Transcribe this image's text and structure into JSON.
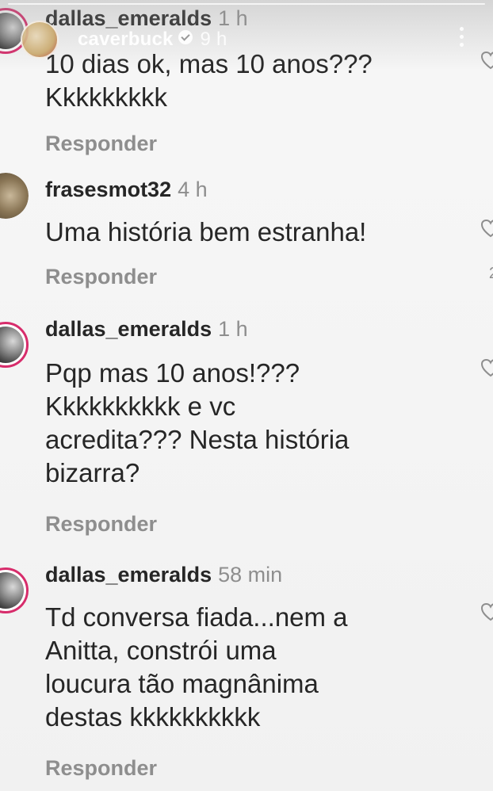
{
  "story": {
    "username": "caverbuck",
    "time": "9 h"
  },
  "comments": [
    {
      "username": "dallas_emeralds",
      "time": "1 h",
      "text": "10 dias ok, mas 10 anos???\nKkkkkkkkk",
      "reply_label": "Responder",
      "avatar": "profile-photo",
      "story_ring": true
    },
    {
      "username": "frasesmot32",
      "time": "4 h",
      "text": "Uma história bem estranha!",
      "reply_label": "Responder",
      "avatar": "profile-photo",
      "story_ring": false,
      "like_count": "2"
    },
    {
      "username": "dallas_emeralds",
      "time": "1 h",
      "text": "Pqp mas 10 anos!???\nKkkkkkkkkk e vc\nacredita??? Nesta história\nbizarra?",
      "reply_label": "Responder",
      "avatar": "profile-photo",
      "story_ring": true
    },
    {
      "username": "dallas_emeralds",
      "time": "58 min",
      "text": "Td conversa fiada...nem a\nAnitta, constrói uma\nloucura tão magnânima\ndestas kkkkkkkkkk",
      "reply_label": "Responder",
      "avatar": "profile-photo",
      "story_ring": true
    }
  ],
  "colors": {
    "text": "#262626",
    "secondary": "#8e8e8e",
    "story_ring": "#d72c6b"
  },
  "icons": [
    "heart-icon",
    "verified-icon",
    "more-icon"
  ]
}
